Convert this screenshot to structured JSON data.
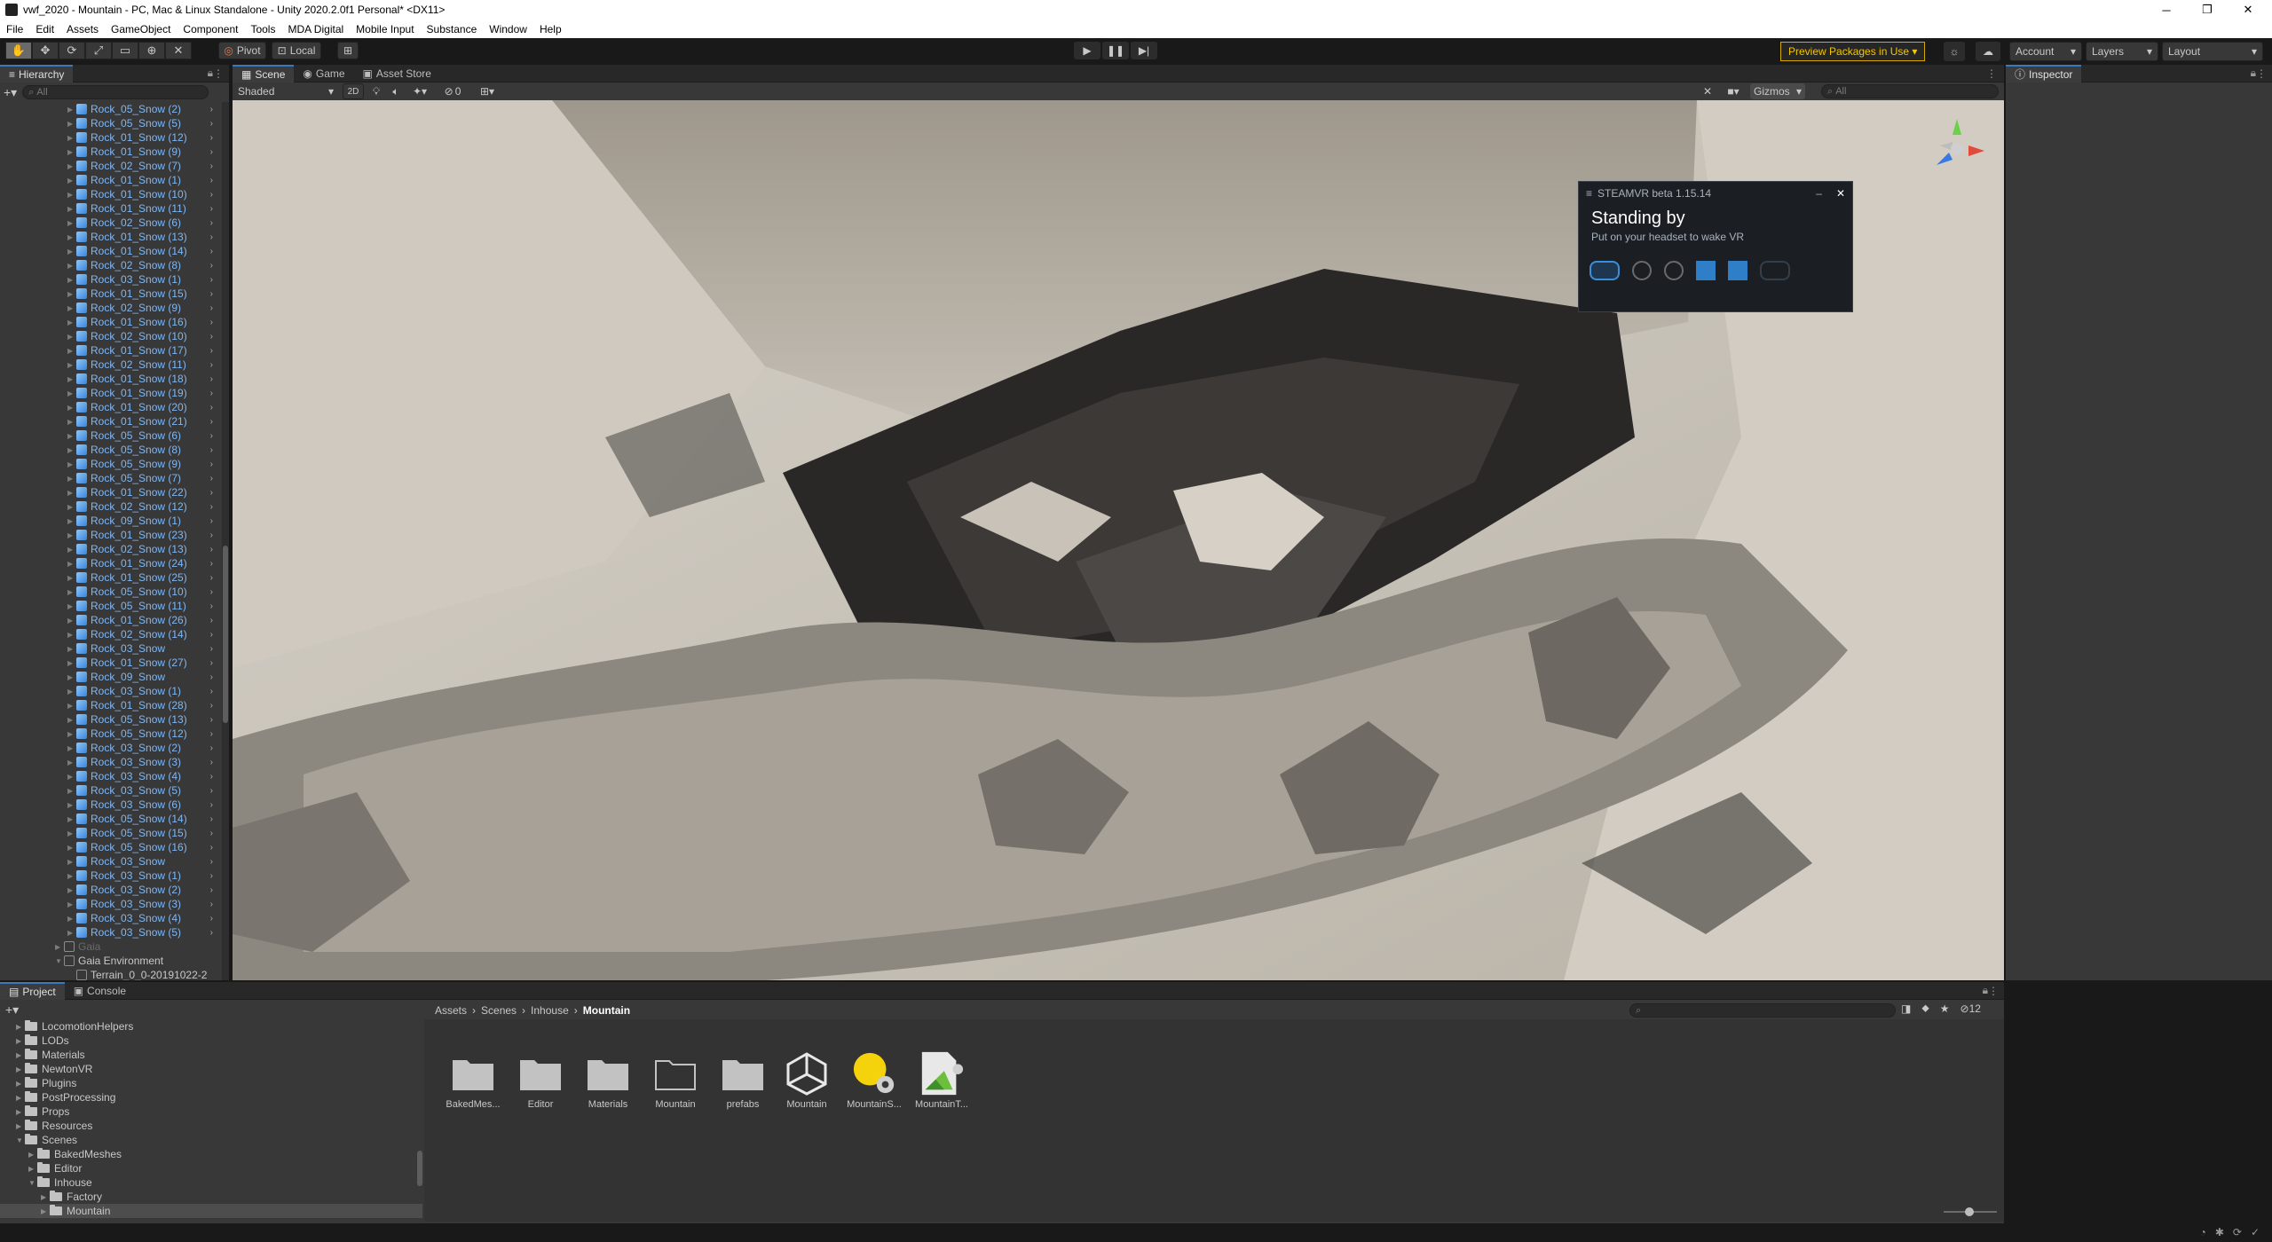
{
  "window": {
    "title": "vwf_2020 - Mountain - PC, Mac & Linux Standalone - Unity 2020.2.0f1 Personal* <DX11>",
    "minimize": "─",
    "maximize": "❐",
    "close": "✕"
  },
  "menu": [
    "File",
    "Edit",
    "Assets",
    "GameObject",
    "Component",
    "Tools",
    "MDA Digital",
    "Mobile Input",
    "Substance",
    "Window",
    "Help"
  ],
  "toolbar": {
    "pivot": "Pivot",
    "local": "Local",
    "preview_packages": "Preview Packages in Use",
    "account": "Account",
    "layers": "Layers",
    "layout": "Layout"
  },
  "hierarchy": {
    "tab": "Hierarchy",
    "search_placeholder": "All",
    "items": [
      "Rock_05_Snow (2)",
      "Rock_05_Snow (5)",
      "Rock_01_Snow (12)",
      "Rock_01_Snow (9)",
      "Rock_02_Snow (7)",
      "Rock_01_Snow (1)",
      "Rock_01_Snow (10)",
      "Rock_01_Snow (11)",
      "Rock_02_Snow (6)",
      "Rock_01_Snow (13)",
      "Rock_01_Snow (14)",
      "Rock_02_Snow (8)",
      "Rock_03_Snow (1)",
      "Rock_01_Snow (15)",
      "Rock_02_Snow (9)",
      "Rock_01_Snow (16)",
      "Rock_02_Snow (10)",
      "Rock_01_Snow (17)",
      "Rock_02_Snow (11)",
      "Rock_01_Snow (18)",
      "Rock_01_Snow (19)",
      "Rock_01_Snow (20)",
      "Rock_01_Snow (21)",
      "Rock_05_Snow (6)",
      "Rock_05_Snow (8)",
      "Rock_05_Snow (9)",
      "Rock_05_Snow (7)",
      "Rock_01_Snow (22)",
      "Rock_02_Snow (12)",
      "Rock_09_Snow (1)",
      "Rock_01_Snow (23)",
      "Rock_02_Snow (13)",
      "Rock_01_Snow (24)",
      "Rock_01_Snow (25)",
      "Rock_05_Snow (10)",
      "Rock_05_Snow (11)",
      "Rock_01_Snow (26)",
      "Rock_02_Snow (14)",
      "Rock_03_Snow",
      "Rock_01_Snow (27)",
      "Rock_09_Snow",
      "Rock_03_Snow (1)",
      "Rock_01_Snow (28)",
      "Rock_05_Snow (13)",
      "Rock_05_Snow (12)",
      "Rock_03_Snow (2)",
      "Rock_03_Snow (3)",
      "Rock_03_Snow (4)",
      "Rock_03_Snow (5)",
      "Rock_03_Snow (6)",
      "Rock_05_Snow (14)",
      "Rock_05_Snow (15)",
      "Rock_05_Snow (16)",
      "Rock_03_Snow",
      "Rock_03_Snow (1)",
      "Rock_03_Snow (2)",
      "Rock_03_Snow (3)",
      "Rock_03_Snow (4)",
      "Rock_03_Snow (5)"
    ],
    "gaia": "Gaia",
    "gaia_environment": "Gaia Environment",
    "terrain": "Terrain_0_0-20191022-2"
  },
  "scene": {
    "tabs": [
      "Scene",
      "Game",
      "Asset Store"
    ],
    "shading": "Shaded",
    "mode_2d": "2D",
    "hidden_count": "0",
    "gizmos": "Gizmos",
    "search_placeholder": "All"
  },
  "steamvr": {
    "title": "STEAMVR beta 1.15.14",
    "status": "Standing by",
    "subtitle": "Put on your headset to wake VR"
  },
  "inspector": {
    "tab": "Inspector"
  },
  "project": {
    "tabs": [
      "Project",
      "Console"
    ],
    "tree": [
      {
        "name": "LocomotionHelpers",
        "depth": 1,
        "open": false
      },
      {
        "name": "LODs",
        "depth": 1,
        "open": false
      },
      {
        "name": "Materials",
        "depth": 1,
        "open": false
      },
      {
        "name": "NewtonVR",
        "depth": 1,
        "open": false
      },
      {
        "name": "Plugins",
        "depth": 1,
        "open": false
      },
      {
        "name": "PostProcessing",
        "depth": 1,
        "open": false
      },
      {
        "name": "Props",
        "depth": 1,
        "open": false
      },
      {
        "name": "Resources",
        "depth": 1,
        "open": false
      },
      {
        "name": "Scenes",
        "depth": 1,
        "open": true
      },
      {
        "name": "BakedMeshes",
        "depth": 2,
        "open": false
      },
      {
        "name": "Editor",
        "depth": 2,
        "open": false
      },
      {
        "name": "Inhouse",
        "depth": 2,
        "open": true
      },
      {
        "name": "Factory",
        "depth": 3,
        "open": false
      },
      {
        "name": "Mountain",
        "depth": 3,
        "open": false
      }
    ],
    "breadcrumb": [
      "Assets",
      "Scenes",
      "Inhouse",
      "Mountain"
    ],
    "assets": [
      "BakedMes...",
      "Editor",
      "Materials",
      "Mountain",
      "prefabs",
      "Mountain",
      "MountainS...",
      "MountainT..."
    ],
    "hidden_count": "12"
  }
}
